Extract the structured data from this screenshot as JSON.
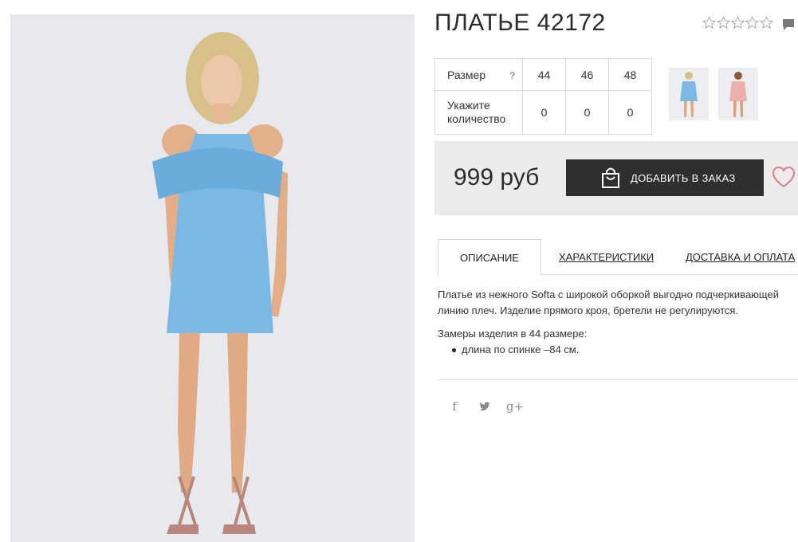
{
  "product": {
    "title": "ПЛАТЬЕ 42172",
    "rating_stars": 5,
    "rating_value": 0
  },
  "sizes": {
    "size_label": "Размер",
    "help": "?",
    "qty_label_line1": "Укажите",
    "qty_label_line2": "количество",
    "columns": [
      "44",
      "46",
      "48"
    ],
    "quantities": [
      "0",
      "0",
      "0"
    ]
  },
  "thumbnails": [
    {
      "name": "blue-dress-thumbnail",
      "color": "#7db8e3"
    },
    {
      "name": "pink-dress-thumbnail",
      "color": "#eab0aa"
    }
  ],
  "buy": {
    "price": "999 руб",
    "add_label": "ДОБАВИТЬ В ЗАКАЗ",
    "icons": {
      "bag": "shopping-bag-icon",
      "favorite": "heart-icon"
    }
  },
  "tabs": [
    {
      "label": "ОПИСАНИЕ",
      "active": true
    },
    {
      "label": "ХАРАКТЕРИСТИКИ",
      "active": false
    },
    {
      "label": "ДОСТАВКА И ОПЛАТА",
      "active": false
    }
  ],
  "description": {
    "text": "Платье из нежного Softa с широкой оборкой выгодно подчеркивающей линию плеч. Изделие прямого кроя, бретели не регулируются.",
    "measures_title": "Замеры изделия в 44 размере:",
    "measures": [
      "длина по спинке –84 см."
    ]
  },
  "social": {
    "facebook": "f",
    "twitter": "twitter-icon",
    "googleplus": "g+"
  },
  "colors": {
    "accent_dark": "#2f2f2f",
    "heart": "#e27b8c",
    "dress_blue": "#7db8e3",
    "panel_bg": "#ececec"
  }
}
